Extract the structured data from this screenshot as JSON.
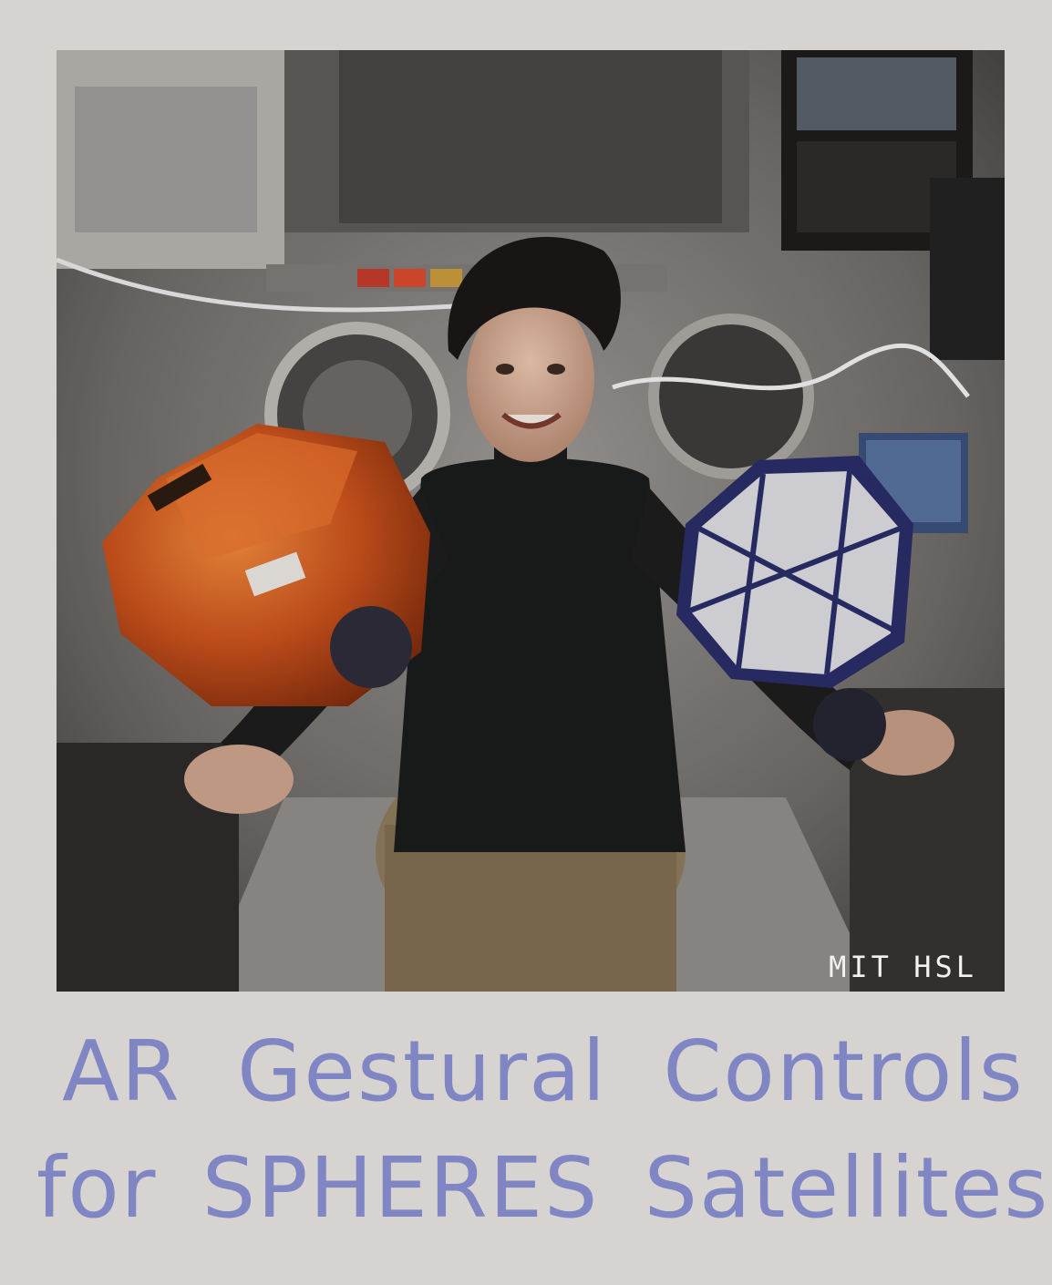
{
  "photo": {
    "watermark": "MIT HSL",
    "subjects": [
      "astronaut",
      "orange-spheres-satellite",
      "blue-spheres-satellite",
      "laptop"
    ]
  },
  "caption": {
    "line1": "AR Gestural Controls",
    "line2": "for SPHERES Satellites"
  },
  "colors": {
    "frame": "#d7d3d1",
    "caption_ink": "#7f86c3",
    "watermark": "#f2f2f2",
    "orange_satellite": "#d0521f",
    "blue_satellite": "#2c2f6e"
  }
}
